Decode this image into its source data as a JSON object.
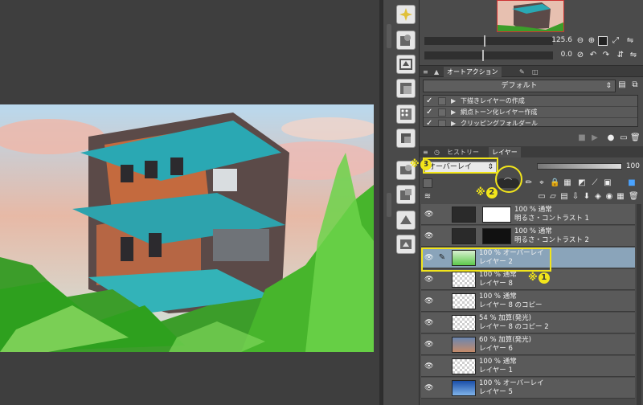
{
  "navigator": {
    "zoom": "125.6",
    "rotation": "0.0"
  },
  "auto_action": {
    "tabs": [
      "オートアクション"
    ],
    "set_name": "デフォルト",
    "items": [
      {
        "label": "下描きレイヤーの作成",
        "checked": true
      },
      {
        "label": "網点トーン化レイヤー作成",
        "checked": true
      },
      {
        "label": "クリッピングフォルダール",
        "checked": true
      }
    ]
  },
  "layer_panel": {
    "tabs": [
      "ヒストリー",
      "レイヤー"
    ],
    "blend_mode": "オーバーレイ",
    "opacity": "100",
    "layers": [
      {
        "line1": "100 % 通常",
        "line2": "明るさ・コントラスト 1",
        "type": "correction",
        "selected": false
      },
      {
        "line1": "100 % 通常",
        "line2": "明るさ・コントラスト 2",
        "type": "correction",
        "selected": false
      },
      {
        "line1": "100 % オーバーレイ",
        "line2": "レイヤー 2",
        "type": "raster",
        "selected": true
      },
      {
        "line1": "100 % 通常",
        "line2": "レイヤー 8",
        "type": "raster",
        "selected": false
      },
      {
        "line1": "100 % 通常",
        "line2": "レイヤー 8 のコピー",
        "type": "raster",
        "selected": false
      },
      {
        "line1": "54 % 加算(発光)",
        "line2": "レイヤー 8 のコピー 2",
        "type": "raster",
        "selected": false
      },
      {
        "line1": "60 % 加算(発光)",
        "line2": "レイヤー 6",
        "type": "raster",
        "selected": false
      },
      {
        "line1": "100 % 通常",
        "line2": "レイヤー 1",
        "type": "raster",
        "selected": false
      },
      {
        "line1": "100 % オーバーレイ",
        "line2": "レイヤー 5",
        "type": "raster",
        "selected": false
      }
    ]
  },
  "annotations": {
    "mark": "※",
    "one": "1",
    "two": "2",
    "three": "3"
  },
  "colors": {
    "annotation": "#f2e51b",
    "selected_layer": "#8aa4ba",
    "panel": "#4b4b4b"
  }
}
